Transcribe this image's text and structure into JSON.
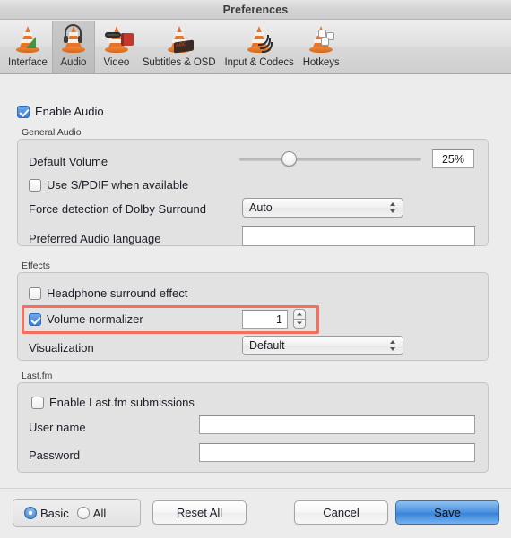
{
  "window": {
    "title": "Preferences"
  },
  "toolbar": {
    "items": [
      {
        "label": "Interface",
        "icon": "vlc-cone-interface-icon",
        "selected": false
      },
      {
        "label": "Audio",
        "icon": "vlc-cone-headset-icon",
        "selected": true
      },
      {
        "label": "Video",
        "icon": "vlc-cone-film-icon",
        "selected": false
      },
      {
        "label": "Subtitles & OSD",
        "icon": "vlc-cone-subtitles-icon",
        "selected": false
      },
      {
        "label": "Input & Codecs",
        "icon": "vlc-cone-cables-icon",
        "selected": false
      },
      {
        "label": "Hotkeys",
        "icon": "vlc-cone-keys-icon",
        "selected": false
      }
    ]
  },
  "audio": {
    "enable_audio_label": "Enable Audio",
    "enable_audio_checked": true,
    "general_group_title": "General Audio",
    "default_volume_label": "Default Volume",
    "default_volume_value": "25%",
    "default_volume_percent": 25,
    "spdif_label": "Use S/PDIF when available",
    "spdif_checked": false,
    "dolby_label": "Force detection of Dolby Surround",
    "dolby_value": "Auto",
    "preferred_language_label": "Preferred Audio language",
    "preferred_language_value": "",
    "effects_group_title": "Effects",
    "headphone_label": "Headphone surround effect",
    "headphone_checked": false,
    "volume_normalizer_label": "Volume normalizer",
    "volume_normalizer_checked": true,
    "volume_normalizer_value": "1",
    "visualization_label": "Visualization",
    "visualization_value": "Default",
    "lastfm_group_title": "Last.fm",
    "lastfm_enable_label": "Enable Last.fm submissions",
    "lastfm_enable_checked": false,
    "username_label": "User name",
    "username_value": "",
    "password_label": "Password",
    "password_value": ""
  },
  "footer": {
    "mode_basic_label": "Basic",
    "mode_all_label": "All",
    "mode_selected": "Basic",
    "reset_all_label": "Reset All",
    "cancel_label": "Cancel",
    "save_label": "Save"
  },
  "annotation": {
    "highlight_color": "#f4705c",
    "highlight_target": "volume-normalizer-row"
  }
}
